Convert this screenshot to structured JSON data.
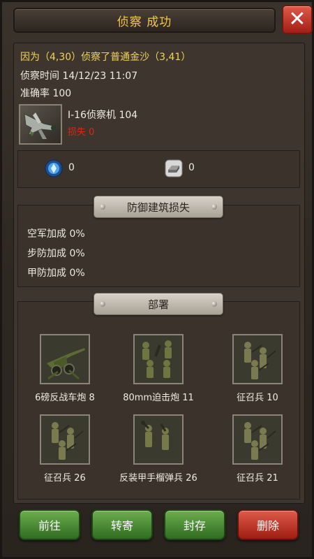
{
  "header": {
    "title": "侦察 成功",
    "close_symbol": "✕"
  },
  "report": {
    "summary": "因为（4,30）侦察了普通金沙（3,41）",
    "time_label": "侦察时间 14/12/23 11:07",
    "accuracy_label": "准确率 100",
    "scout_unit": "I-16侦察机 104",
    "loss_label": "损失 0"
  },
  "resources": [
    {
      "icon": "blue-gem-icon",
      "value": "0"
    },
    {
      "icon": "steel-ingot-icon",
      "value": "0"
    }
  ],
  "defense": {
    "title": "防御建筑损失",
    "stats": [
      "空军加成 0%",
      "步防加成 0%",
      "甲防加成 0%"
    ]
  },
  "deployment": {
    "title": "部署",
    "units": [
      {
        "name": "6磅反战车炮 8",
        "icon": "anti-tank-gun-icon"
      },
      {
        "name": "80mm迫击炮 11",
        "icon": "mortar-crew-icon"
      },
      {
        "name": "征召兵 10",
        "icon": "conscript-icon"
      },
      {
        "name": "征召兵 26",
        "icon": "conscript-icon"
      },
      {
        "name": "反装甲手榴弹兵 26",
        "icon": "grenadier-icon"
      },
      {
        "name": "征召兵 21",
        "icon": "conscript-icon"
      }
    ]
  },
  "actions": {
    "go": "前往",
    "forward": "转寄",
    "archive": "封存",
    "delete": "删除"
  },
  "colors": {
    "title_gold": "#f2c94c",
    "summary_yellow": "#f2d35a",
    "loss_red": "#d8281c",
    "button_green": "#4e8c36",
    "button_red": "#c03a2c"
  }
}
